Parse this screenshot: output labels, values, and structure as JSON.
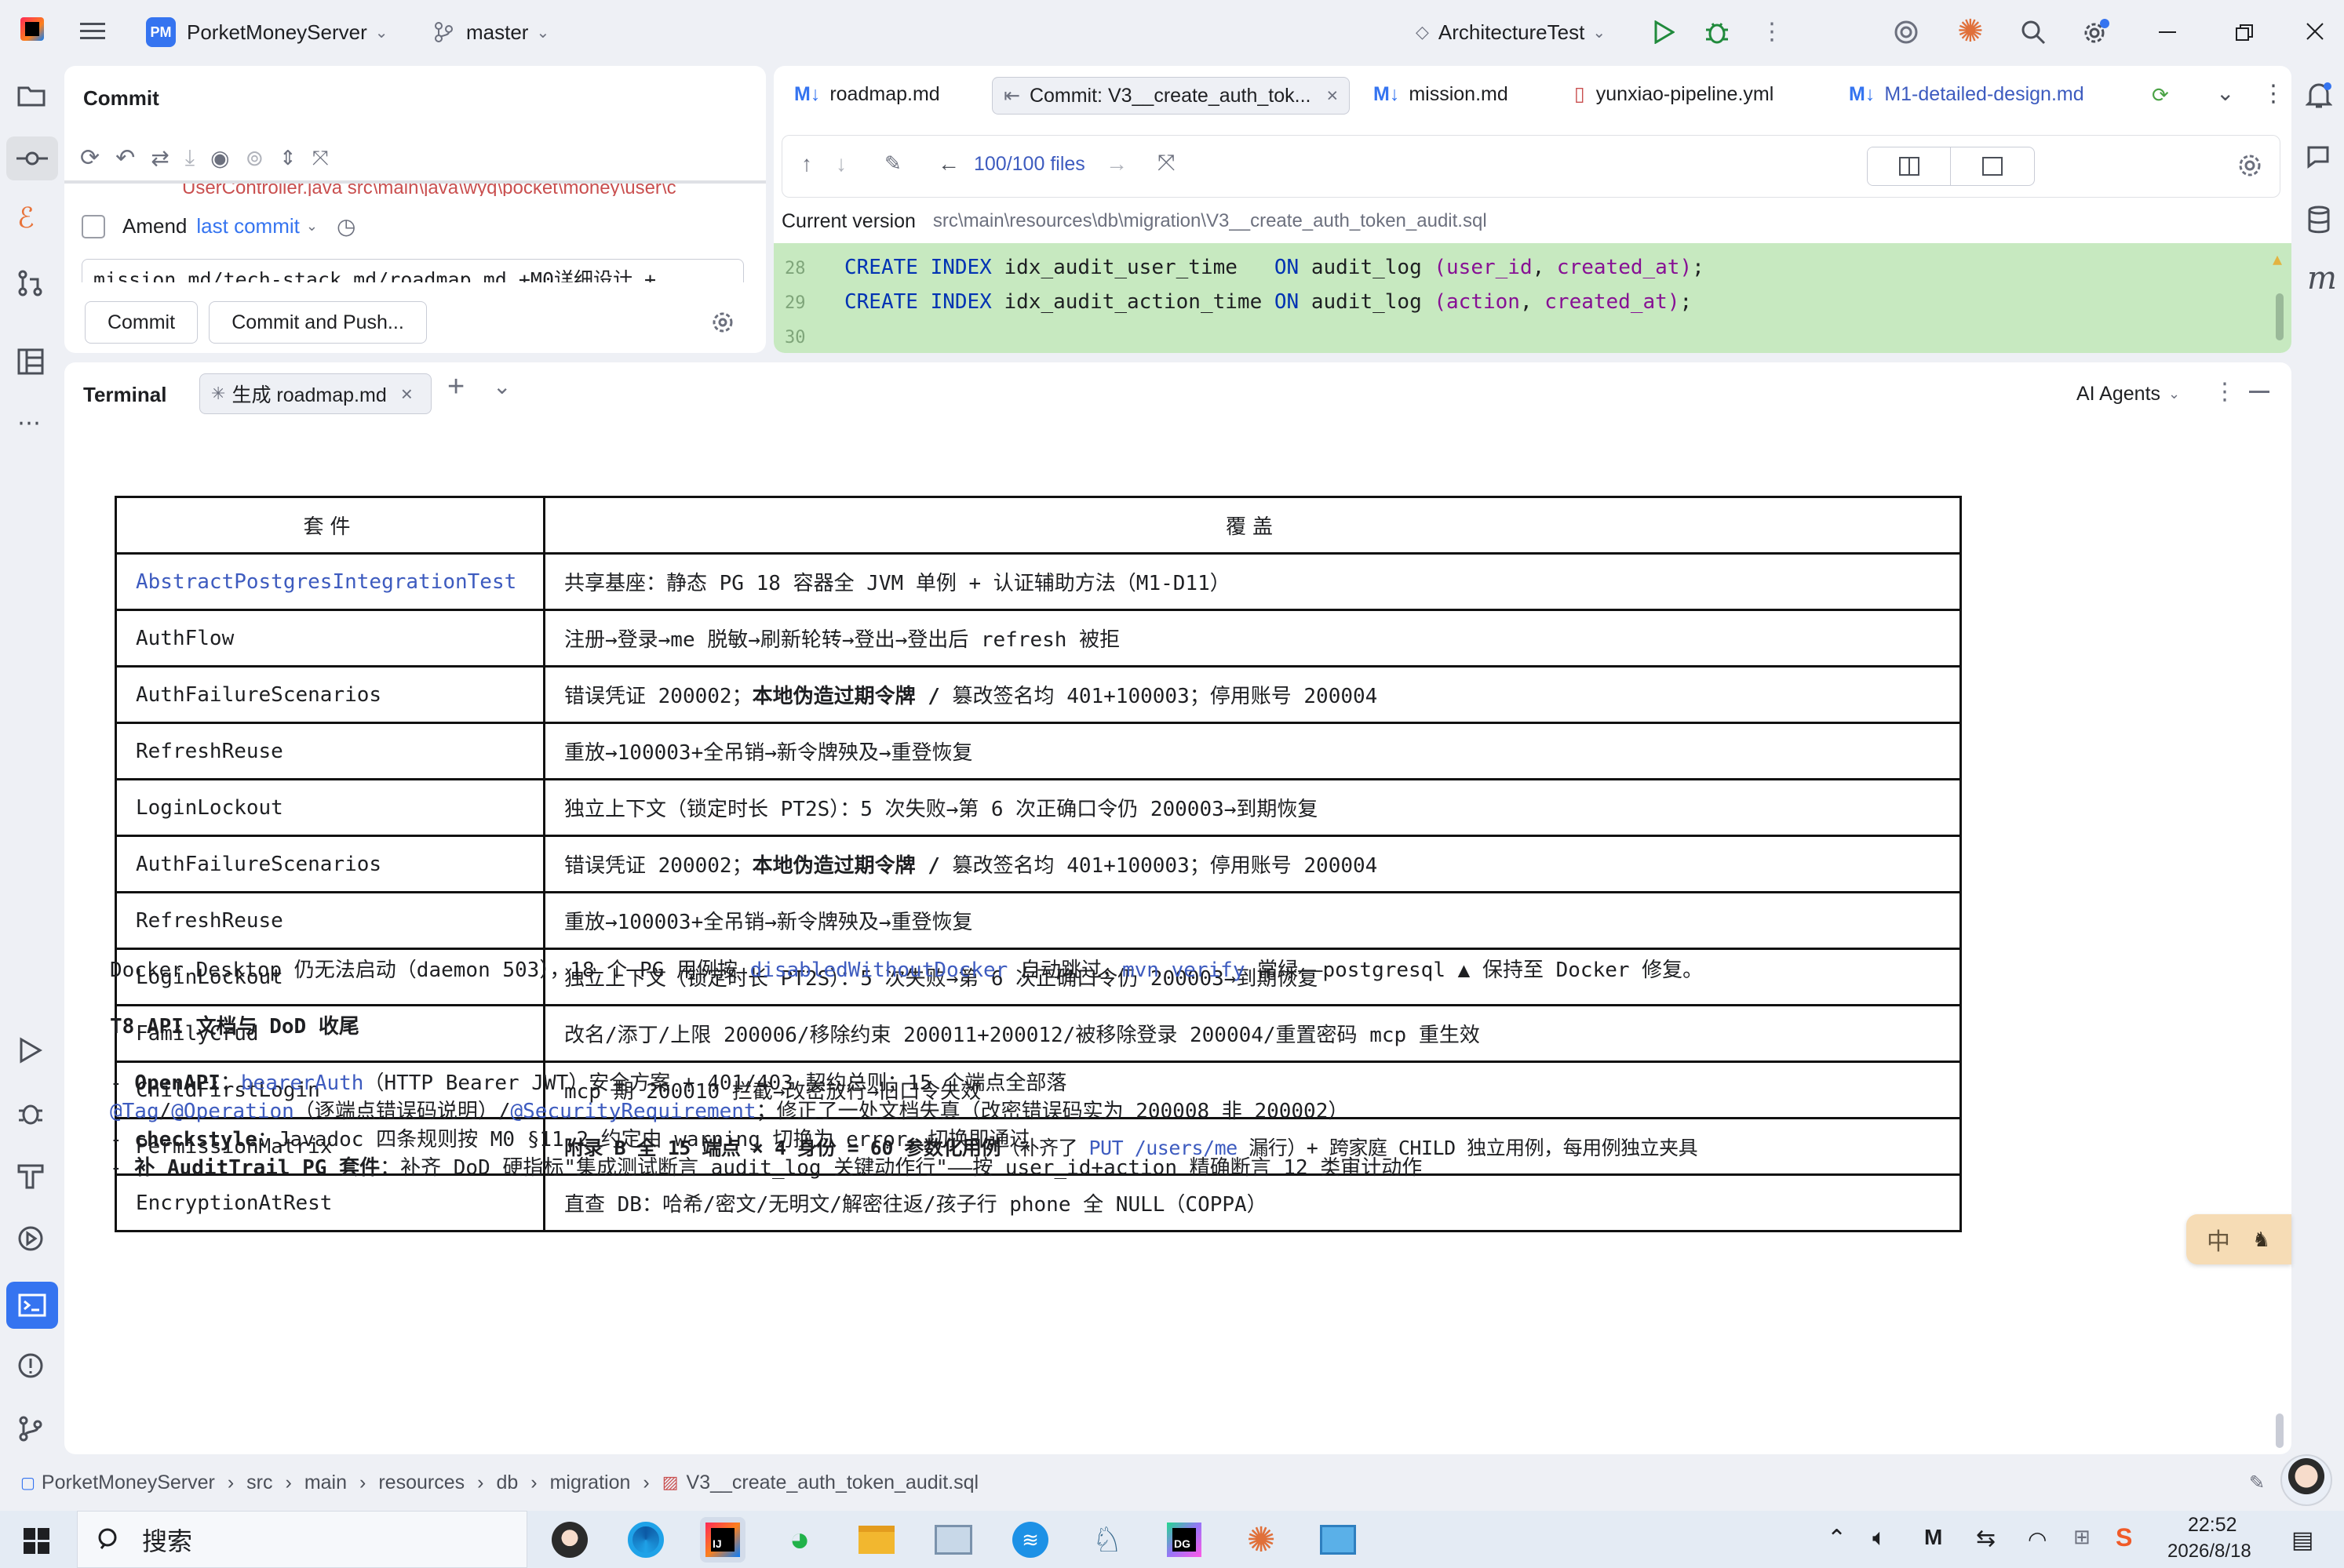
{
  "titlebar": {
    "project_badge": "PM",
    "project": "PorketMoneyServer",
    "branch": "master",
    "run_config": "ArchitectureTest"
  },
  "commit_panel": {
    "title": "Commit",
    "file_row": "UserController.java  src\\main\\java\\wyq\\pocket\\money\\user\\c",
    "amend_label": "Amend",
    "last_commit_label": "last commit",
    "message": "mission.md/tech-stack.md/roadmap.md +M0详细设计 +..",
    "commit_button": "Commit",
    "commit_push_button": "Commit and Push..."
  },
  "editor": {
    "tabs": [
      {
        "icon": "M↓",
        "label": "roadmap.md"
      },
      {
        "icon": "",
        "label": "Commit: V3__create_auth_tok..."
      },
      {
        "icon": "M↓",
        "label": "mission.md"
      },
      {
        "icon": "",
        "label": "yunxiao-pipeline.yml"
      },
      {
        "icon": "M↓",
        "label": "M1-detailed-design.md"
      }
    ],
    "files_counter": "100/100 files",
    "current_version_label": "Current version",
    "current_version_path": "src\\main\\resources\\db\\migration\\V3__create_auth_token_audit.sql",
    "lines": [
      {
        "num": "28",
        "text": "CREATE INDEX idx_audit_user_time   ON audit_log (user_id, created_at);"
      },
      {
        "num": "29",
        "text": "CREATE INDEX idx_audit_action_time ON audit_log (action, created_at);"
      },
      {
        "num": "30",
        "text": ""
      }
    ]
  },
  "terminal": {
    "title": "Terminal",
    "tab_label": "生成 roadmap.md",
    "ai_agents": "AI Agents",
    "table_headers": [
      "套件",
      "覆盖"
    ],
    "table_rows": [
      {
        "suite": "AbstractPostgresIntegrationTest",
        "desc": "共享基座：静态 PG 18 容器全 JVM 单例 + 认证辅助方法（M1-D11）"
      },
      {
        "suite": "AuthFlow",
        "desc": "注册→登录→me 脱敏→刷新轮转→登出→登出后 refresh 被拒"
      },
      {
        "suite": "AuthFailureScenarios",
        "desc_a": "错误凭证 200002；",
        "desc_b": "本地伪造过期令牌 /",
        "desc_c": " 篡改签名均 401+100003；停用账号 200004"
      },
      {
        "suite": "RefreshReuse",
        "desc": "重放→100003+全吊销→新令牌殃及→重登恢复"
      },
      {
        "suite": "LoginLockout",
        "desc": "独立上下文（锁定时长 PT2S）：5 次失败→第 6 次正确口令仍 200003→到期恢复"
      },
      {
        "suite": "AuthFailureScenarios",
        "desc_a": "错误凭证 200002；",
        "desc_b": "本地伪造过期令牌 /",
        "desc_c": " 篡改签名均 401+100003；停用账号 200004"
      },
      {
        "suite": "RefreshReuse",
        "desc": "重放→100003+全吊销→新令牌殃及→重登恢复"
      },
      {
        "suite": "LoginLockout",
        "desc": "独立上下文（锁定时长 PT2S）：5 次失败→第 6 次正确口令仍 200003→到期恢复"
      },
      {
        "suite": "FamilyCrud",
        "desc": "改名/添丁/上限 200006/移除约束 200011+200012/被移除登录 200004/重置密码 mcp 重生效"
      },
      {
        "suite": "ChildFirstLogin",
        "desc": "mcp 期 200010 拦截→改密放行→旧口令失效"
      },
      {
        "suite": "PermissionMatrix",
        "desc_a": "附录 B 全 15 端点 × 4 身份 = 60 参数化用例",
        "desc_b": "（补齐了 ",
        "desc_c": "PUT /users/me",
        "desc_d": " 漏行）+ 跨家庭 CHILD 独立用例，每用例独立夹具"
      },
      {
        "suite": "EncryptionAtRest",
        "desc": "直查 DB：哈希/密文/无明文/解密往返/孩子行 phone 全 NULL（COPPA）"
      }
    ],
    "docker_line": {
      "a": "Docker Desktop 仍无法启动（daemon 503），18 个 PG 用例按 ",
      "b": "disabledWithoutDocker",
      "c": " 自动跳过，",
      "d": "mvn verify",
      "e": " 常绿——postgresql ▲  保持至 Docker 修复。"
    },
    "t8_heading": "T8 API 文档与 DoD 收尾",
    "openapi_line": {
      "a": "- ",
      "b": "OpenAPI",
      "c": "：",
      "d": "bearerAuth",
      "e": "（HTTP Bearer JWT）安全方案 + 401/403 契约总则；15 个端点全部落"
    },
    "openapi_line2": {
      "a": "@Tag",
      "b": "/",
      "c": "@Operation",
      "d": "（逐端点错误码说明）/",
      "e": "@SecurityRequirement",
      "f": "；修正了一处文档失真（改密错误码实为 200008 非 200002）"
    },
    "checkstyle_line": {
      "a": "- ",
      "b": "checkstyle",
      "c": "：Javadoc 四条规则按 M0 §11.2 约定由 warning 切换为 error，切换即通过"
    },
    "audit_line": {
      "a": "- ",
      "b": "补 AuditTrail PG 套件",
      "c": "：补齐 DoD 硬指标\"集成测试断言 audit_log 关键动作行\"——按 user_id+action 精确断言 12 类审计动作"
    }
  },
  "ime": {
    "label": "中"
  },
  "statusbar": {
    "breadcrumb": [
      "PorketMoneyServer",
      "src",
      "main",
      "resources",
      "db",
      "migration",
      "V3__create_auth_token_audit.sql"
    ]
  },
  "taskbar": {
    "search_placeholder": "搜索",
    "time": "22:52",
    "date": "2026/8/18",
    "lang": "中"
  },
  "colors": {
    "accent": "#3574f0",
    "diff_green": "#c7e9c0",
    "link": "#3d5bbf"
  }
}
